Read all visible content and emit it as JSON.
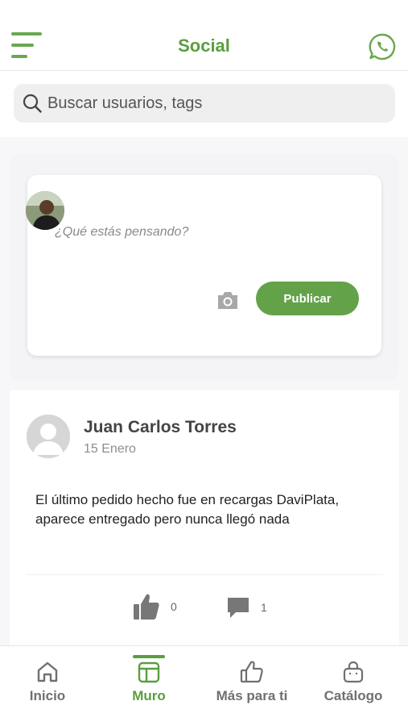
{
  "header": {
    "title": "Social",
    "menu_icon": "hamburger-menu-icon",
    "action_icon": "whatsapp-icon"
  },
  "search": {
    "placeholder": "Buscar usuarios, tags",
    "icon": "search-icon"
  },
  "composer": {
    "placeholder": "¿Qué estás pensando?",
    "publish_label": "Publicar",
    "camera_icon": "camera-icon"
  },
  "post": {
    "author": "Juan Carlos Torres",
    "date": "15 Enero",
    "body": "El último pedido hecho fue en recargas DaviPlata, aparece entregado pero nunca llegó nada",
    "likes": "0",
    "comments": "1"
  },
  "bottom_nav": {
    "items": [
      {
        "label": "Inicio",
        "icon": "home-icon",
        "active": false
      },
      {
        "label": "Muro",
        "icon": "wall-layout-icon",
        "active": true
      },
      {
        "label": "Más para ti",
        "icon": "thumbs-up-icon",
        "active": false
      },
      {
        "label": "Catálogo",
        "icon": "shopping-bag-icon",
        "active": false
      }
    ]
  },
  "colors": {
    "brand_green": "#5a9e3f",
    "button_green": "#64a24a",
    "inactive_gray": "#707070"
  }
}
